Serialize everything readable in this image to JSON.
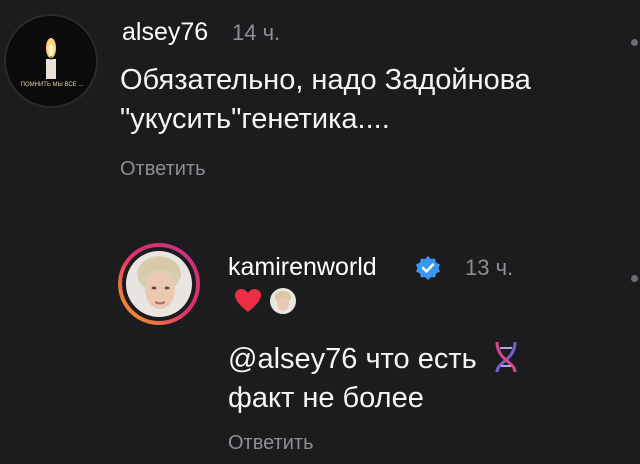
{
  "comments": [
    {
      "username": "alsey76",
      "time": "14 ч.",
      "avatar_caption": "ПОМНИТЬ МЫ ВСЕ ...",
      "text_lines": [
        "Обязательно, надо Задойнова",
        "\"укусить\"генетика...."
      ],
      "reply_label": "Ответить"
    },
    {
      "username": "kamirenworld",
      "verified_icon": "verified-badge-icon",
      "time": "13 ч.",
      "liked_by_author": true,
      "text_lines": [
        "@alsey76 что есть",
        "факт не более"
      ],
      "text_emoji": "dna-icon",
      "reply_label": "Ответить"
    }
  ],
  "colors": {
    "background": "#1c1c1e",
    "secondary_text": "#8e8e93",
    "heart": "#ed2d45",
    "verified": "#3897f0",
    "story_ring_start": "#f5a623",
    "story_ring_end": "#c13584"
  }
}
